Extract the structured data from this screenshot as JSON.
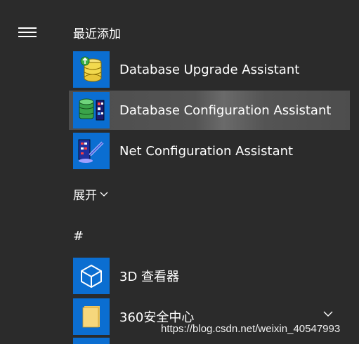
{
  "menu": {
    "hamburger_icon": "hamburger-menu-icon"
  },
  "sections": {
    "recent_label": "最近添加",
    "expand_label": "展开",
    "hash_label": "#"
  },
  "apps": [
    {
      "label": "Database Upgrade Assistant",
      "icon": "database-upgrade-icon",
      "highlighted": false
    },
    {
      "label": "Database Configuration Assistant",
      "icon": "database-configuration-icon",
      "highlighted": true
    },
    {
      "label": "Net Configuration Assistant",
      "icon": "net-configuration-icon",
      "highlighted": false
    },
    {
      "label": "3D 查看器",
      "icon": "3d-cube-icon",
      "highlighted": false
    },
    {
      "label": "360安全中心",
      "icon": "folder-icon",
      "highlighted": false,
      "expandable": true
    }
  ],
  "watermark": "https://blog.csdn.net/weixin_40547993",
  "colors": {
    "background": "#2b2b2b",
    "tile_blue": "#0b6ed1",
    "highlight": "#545454",
    "text": "#ffffff"
  }
}
